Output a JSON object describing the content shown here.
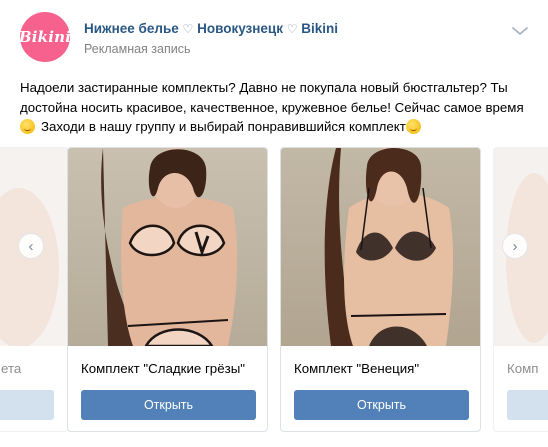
{
  "post": {
    "avatar_text": "Bikini",
    "title": "Нижнее белье ♡ Новокузнецк ♡ Bikini",
    "title_parts": [
      "Нижнее белье",
      "♡",
      "Новокузнецк",
      "♡",
      "Bikini"
    ],
    "subtitle": "Рекламная запись",
    "more_icon": "chevron-down-icon",
    "text_line1": "Надоели застиранные комплекты? Давно не покупала новый бюстгальтер? Ты",
    "text_line2": "достойна носить красивое, качественное, кружевное белье! Сейчас самое время",
    "text_line3": "Заходи в нашу группу и выбирай понравившийся комплект"
  },
  "carousel": {
    "prev_icon": "chevron-left-icon",
    "next_icon": "chevron-right-icon",
    "prev_arrow": "‹",
    "next_arrow": "›",
    "cards": [
      {
        "title": "ета",
        "button": ""
      },
      {
        "title": "Комплект \"Сладкие грёзы\"",
        "button": "Открыть"
      },
      {
        "title": "Комплект \"Венеция\"",
        "button": "Открыть"
      },
      {
        "title": "Комп",
        "button": ""
      }
    ]
  },
  "colors": {
    "link": "#2a5885",
    "button": "#5181b8",
    "avatar": "#f6628d",
    "muted": "#828282"
  }
}
